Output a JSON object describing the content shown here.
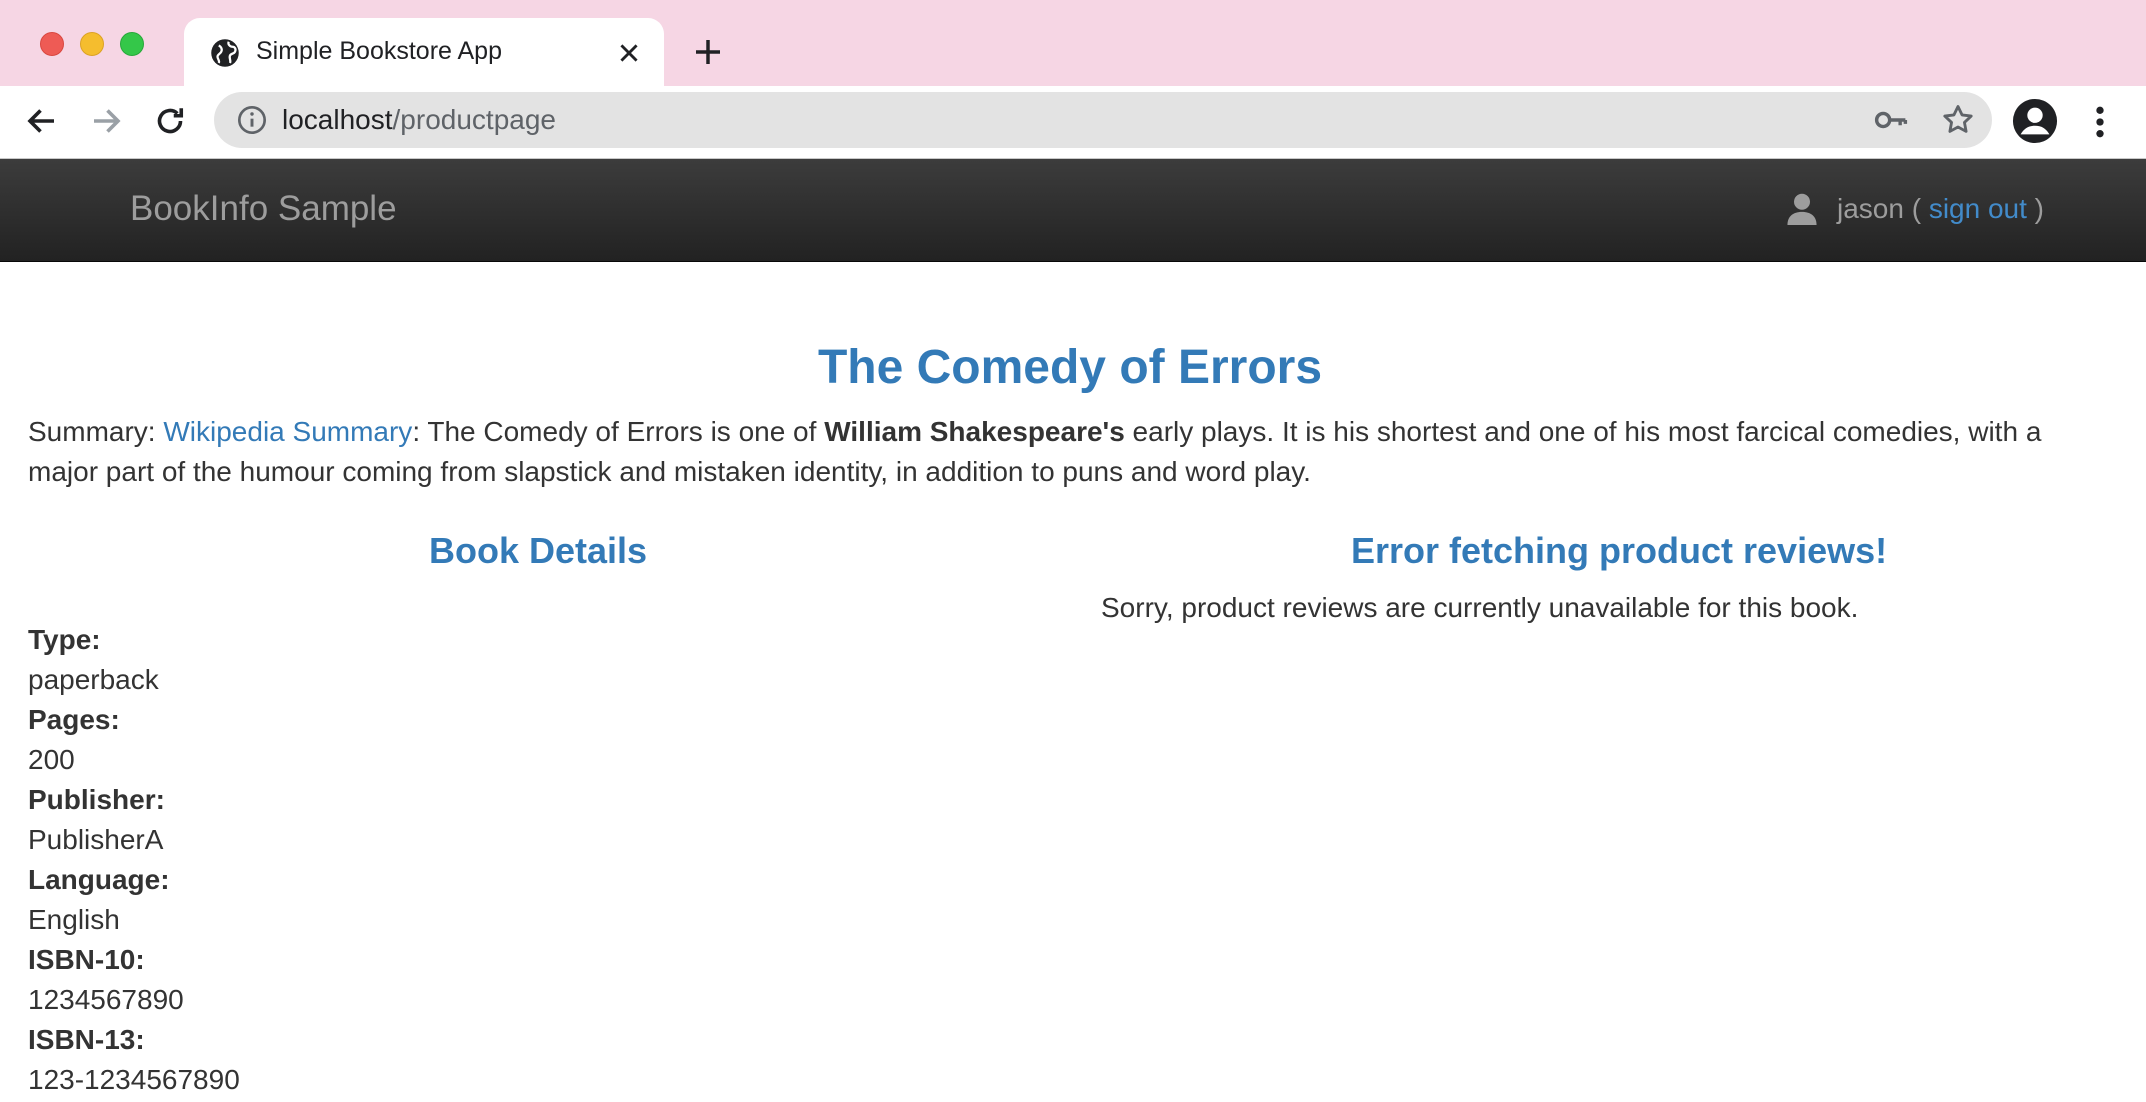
{
  "browser": {
    "tab_title": "Simple Bookstore App",
    "url_host": "localhost",
    "url_path": "/productpage"
  },
  "navbar": {
    "brand": "BookInfo Sample",
    "user_prefix": "jason (",
    "signout_label": "sign out",
    "user_suffix": ")"
  },
  "book": {
    "title": "The Comedy of Errors",
    "summary_label": "Summary:",
    "summary_link": "Wikipedia Summary",
    "summary_text_1": ": The Comedy of Errors is one of",
    "summary_bold": "William Shakespeare's",
    "summary_text_2": "early plays. It is his shortest and one of his most farcical comedies, with a major part of the humour coming from slapstick and mistaken identity, in addition to puns and word play."
  },
  "details": {
    "heading": "Book Details",
    "fields": [
      {
        "label": "Type:",
        "value": "paperback"
      },
      {
        "label": "Pages:",
        "value": "200"
      },
      {
        "label": "Publisher:",
        "value": "PublisherA"
      },
      {
        "label": "Language:",
        "value": "English"
      },
      {
        "label": "ISBN-10:",
        "value": "1234567890"
      },
      {
        "label": "ISBN-13:",
        "value": "123-1234567890"
      }
    ]
  },
  "reviews": {
    "heading": "Error fetching product reviews!",
    "message": "Sorry, product reviews are currently unavailable for this book."
  },
  "colors": {
    "tabstrip": "#f6d6e4",
    "link": "#337ab7",
    "navbar": "#222222"
  }
}
